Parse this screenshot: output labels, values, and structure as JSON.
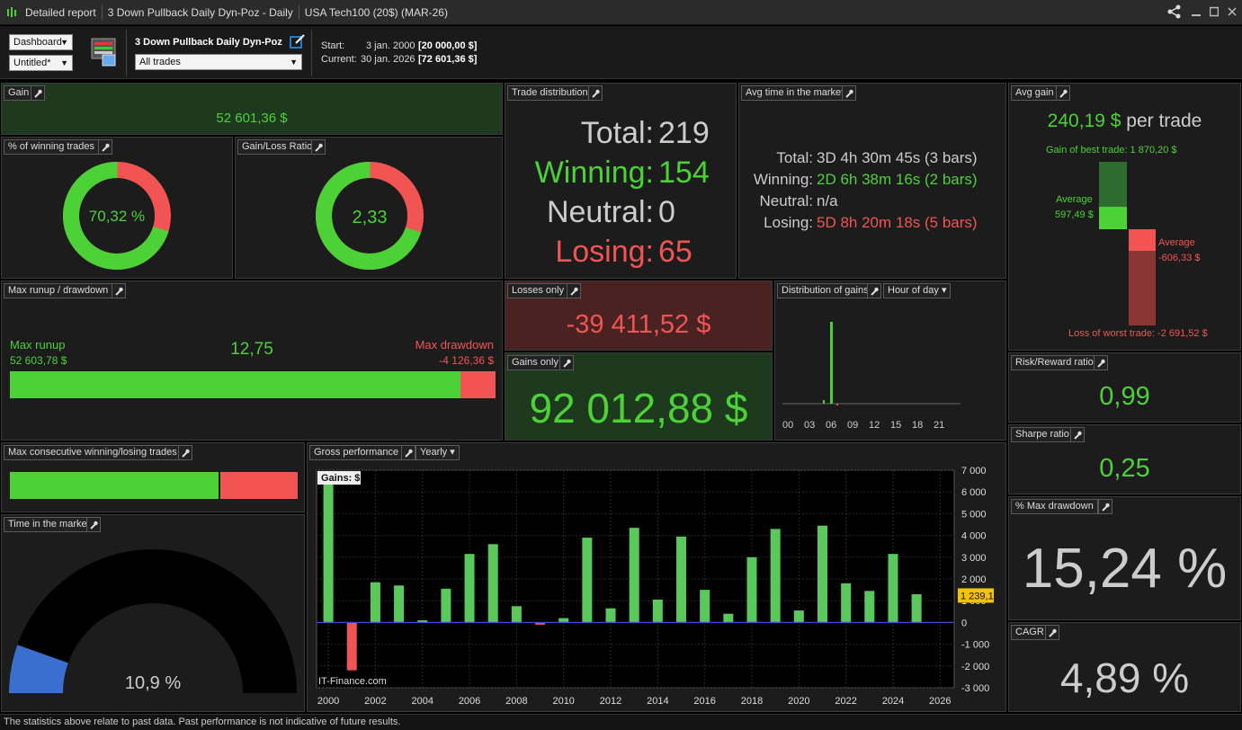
{
  "titlebar": {
    "tabs": [
      "Detailed report",
      "3 Down Pullback Daily Dyn-Poz - Daily",
      "USA Tech100 (20$) (MAR-26)"
    ]
  },
  "toolbar": {
    "view_select": "Dashboard",
    "layout_select": "Untitled*",
    "strategy_name": "3 Down Pullback Daily Dyn-Poz",
    "trades_select": "All trades",
    "start_label": "Start:",
    "start_date": "3 jan. 2000",
    "start_value": "[20 000,00 $]",
    "current_label": "Current:",
    "current_date": "30 jan. 2026",
    "current_value": "[72 601,36 $]"
  },
  "gain": {
    "title": "Gain",
    "value": "52 601,36 $"
  },
  "winning_pct": {
    "title": "% of winning trades",
    "value": "70,32 %",
    "fraction": 0.7032
  },
  "gain_loss": {
    "title": "Gain/Loss Ratio",
    "value": "2,33",
    "fraction": 0.7
  },
  "trade_distribution": {
    "title": "Trade distribution",
    "rows": [
      {
        "label": "Total:",
        "value": "219"
      },
      {
        "label": "Winning:",
        "value": "154"
      },
      {
        "label": "Neutral:",
        "value": "0"
      },
      {
        "label": "Losing:",
        "value": "65"
      }
    ]
  },
  "avg_time": {
    "title": "Avg time in the market",
    "rows": [
      {
        "label": "Total:",
        "value": "3D 4h 30m 45s (3 bars)"
      },
      {
        "label": "Winning:",
        "value": "2D 6h 38m 16s (2 bars)"
      },
      {
        "label": "Neutral:",
        "value": "n/a"
      },
      {
        "label": "Losing:",
        "value": "5D 8h 20m 18s (5 bars)"
      }
    ]
  },
  "avg_gain": {
    "title": "Avg gain",
    "value": "240,19 $",
    "suffix": "per trade",
    "best_label": "Gain of best trade: 1 870,20 $",
    "avg_gain_label": "Average",
    "avg_gain_value": "597,49 $",
    "avg_loss_label": "Average",
    "avg_loss_value": "-606,33 $",
    "worst_label": "Loss of worst trade: -2 691,52 $"
  },
  "max_runup": {
    "title": "Max runup / drawdown",
    "runup_label": "Max runup",
    "runup_value": "52 603,78 $",
    "ratio": "12,75",
    "drawdown_label": "Max drawdown",
    "drawdown_value": "-4 126,36 $",
    "runup_fraction": 0.927
  },
  "losses_only": {
    "title": "Losses only",
    "value": "-39 411,52 $"
  },
  "gains_only": {
    "title": "Gains only",
    "value": "92 012,88 $"
  },
  "dist_gains": {
    "title": "Distribution of gains",
    "dropdown": "Hour of day",
    "xticks": [
      "00",
      "03",
      "06",
      "09",
      "12",
      "15",
      "18",
      "21"
    ]
  },
  "risk_reward": {
    "title": "Risk/Reward ratio",
    "value": "0,99"
  },
  "sharpe": {
    "title": "Sharpe ratio",
    "value": "0,25"
  },
  "max_dd_pct": {
    "title": "% Max drawdown",
    "value": "15,24 %"
  },
  "cagr": {
    "title": "CAGR",
    "value": "4,89 %"
  },
  "max_consec": {
    "title": "Max consecutive winning/losing trades",
    "win_fraction": 0.73
  },
  "time_market": {
    "title": "Time in the market",
    "value": "10,9 %",
    "fraction": 0.109
  },
  "gross_perf": {
    "title": "Gross performance",
    "dropdown": "Yearly"
  },
  "chart_data": {
    "type": "bar",
    "title": "Gains: $",
    "xlabel": "",
    "ylabel": "",
    "categories": [
      "2000",
      "2001",
      "2002",
      "2003",
      "2004",
      "2005",
      "2006",
      "2007",
      "2008",
      "2009",
      "2010",
      "2011",
      "2012",
      "2013",
      "2014",
      "2015",
      "2016",
      "2017",
      "2018",
      "2019",
      "2020",
      "2021",
      "2022",
      "2023",
      "2024",
      "2025"
    ],
    "values": [
      6400,
      -2200,
      1850,
      1700,
      100,
      1550,
      3150,
      3600,
      750,
      -100,
      200,
      3900,
      650,
      4350,
      1050,
      3950,
      1500,
      400,
      3000,
      4300,
      550,
      4450,
      1800,
      1450,
      3150,
      1300
    ],
    "ylim": [
      -3000,
      7000
    ],
    "yticks": [
      "7 000",
      "6 000",
      "5 000",
      "4 000",
      "3 000",
      "2 000",
      "1 000",
      "0",
      "-1 000",
      "-2 000",
      "-3 000"
    ],
    "yticks_num": [
      7000,
      6000,
      5000,
      4000,
      3000,
      2000,
      1000,
      0,
      -1000,
      -2000,
      -3000
    ],
    "xticks": [
      "2000",
      "2002",
      "2004",
      "2006",
      "2008",
      "2010",
      "2012",
      "2014",
      "2016",
      "2018",
      "2020",
      "2022",
      "2024",
      "2026"
    ],
    "marker": "1 239,1",
    "marker_value": 1239.1,
    "watermark": "IT-Finance.com",
    "colors": {
      "positive": "#5ac85a",
      "negative": "#f25454",
      "zero_line": "#3b4bd4"
    }
  },
  "status": {
    "text": "The statistics above relate to past data. Past performance is not indicative of future results."
  }
}
